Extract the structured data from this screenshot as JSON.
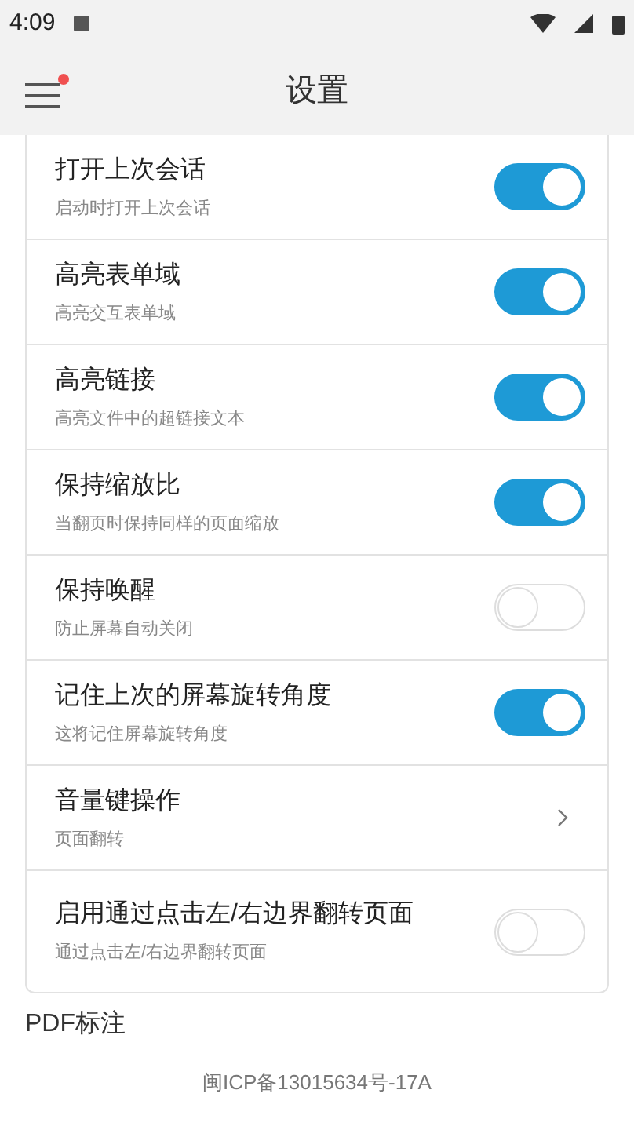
{
  "status_bar": {
    "time": "4:09"
  },
  "header": {
    "title": "设置",
    "menu_badge": true
  },
  "settings": [
    {
      "kind": "toggle",
      "title": "打开上次会话",
      "subtitle": "启动时打开上次会话",
      "on": true
    },
    {
      "kind": "toggle",
      "title": "高亮表单域",
      "subtitle": "高亮交互表单域",
      "on": true
    },
    {
      "kind": "toggle",
      "title": "高亮链接",
      "subtitle": "高亮文件中的超链接文本",
      "on": true
    },
    {
      "kind": "toggle",
      "title": "保持缩放比",
      "subtitle": "当翻页时保持同样的页面缩放",
      "on": true
    },
    {
      "kind": "toggle",
      "title": "保持唤醒",
      "subtitle": "防止屏幕自动关闭",
      "on": false
    },
    {
      "kind": "toggle",
      "title": "记住上次的屏幕旋转角度",
      "subtitle": "这将记住屏幕旋转角度",
      "on": true
    },
    {
      "kind": "link",
      "title": "音量键操作",
      "subtitle": "页面翻转"
    },
    {
      "kind": "toggle",
      "title": "启用通过点击左/右边界翻转页面",
      "subtitle": "通过点击左/右边界翻转页面",
      "on": false
    }
  ],
  "next_section": "PDF标注",
  "footer": "闽ICP备13015634号-17A"
}
